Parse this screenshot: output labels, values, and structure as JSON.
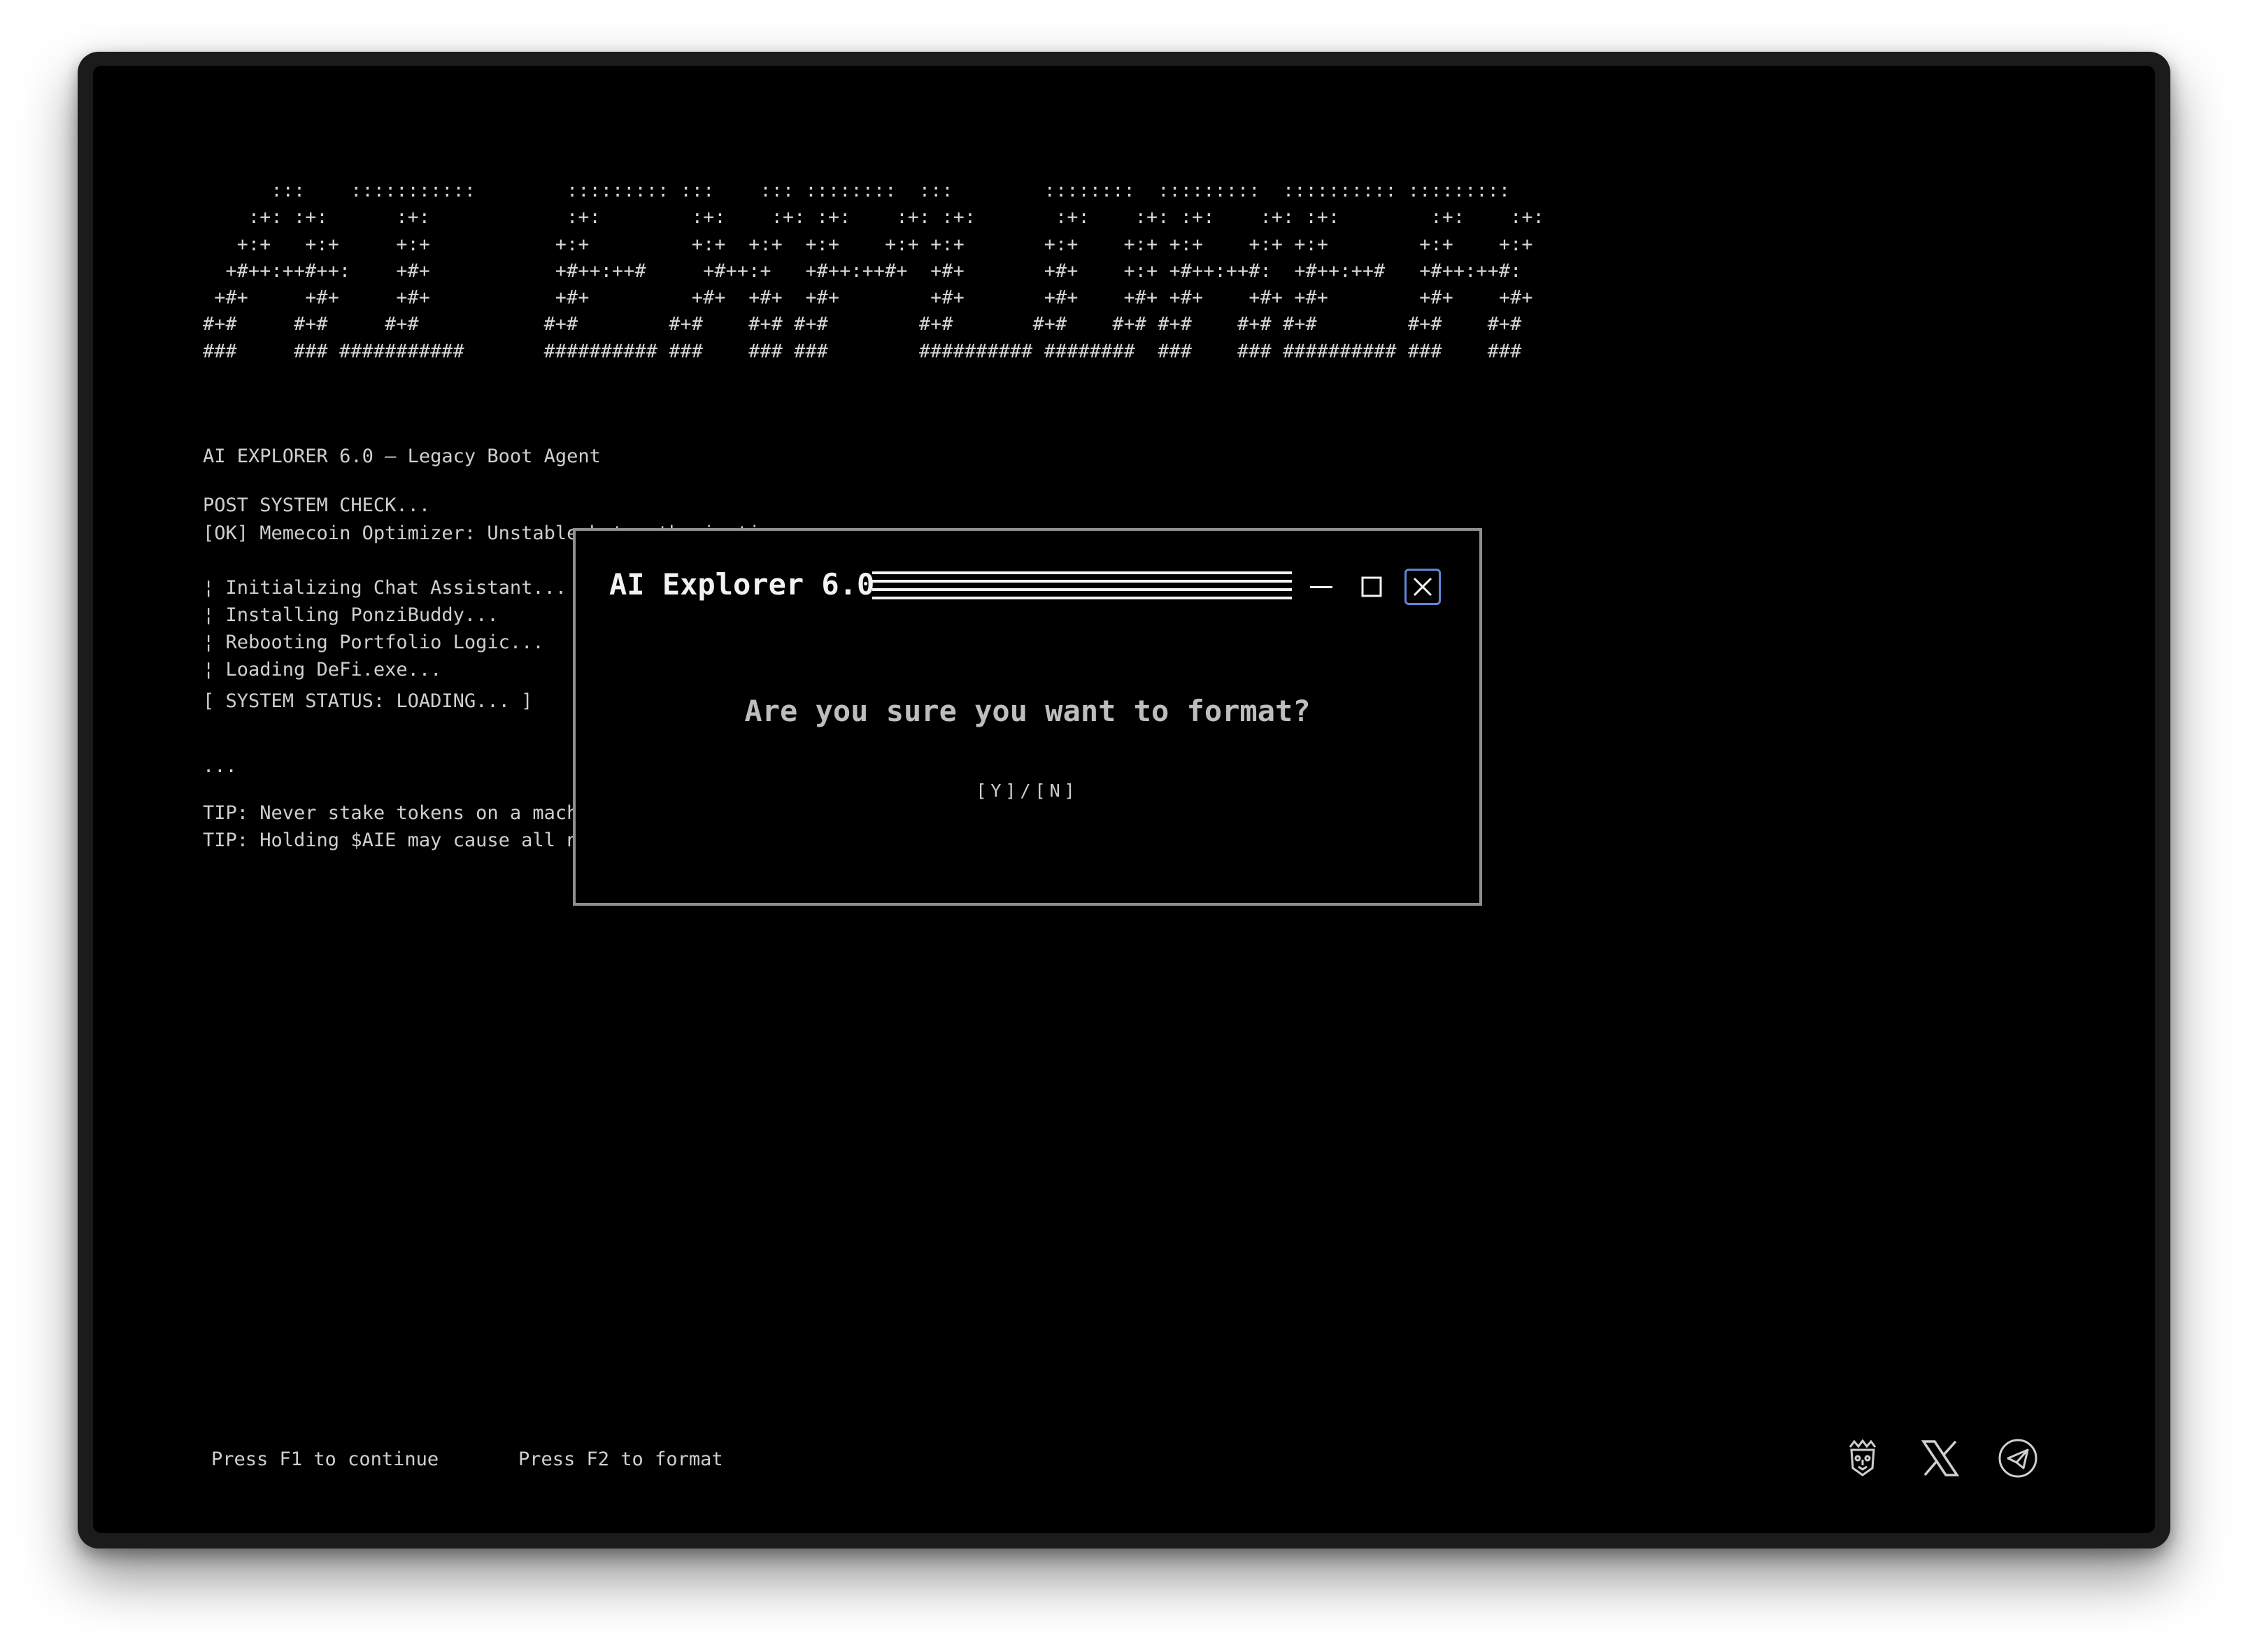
{
  "ascii_logo": "      :::    :::::::::::        ::::::::: :::    ::: ::::::::  :::        ::::::::  :::::::::  :::::::::: ::::::::: \n    :+: :+:      :+:            :+:        :+:    :+: :+:    :+: :+:       :+:    :+: :+:    :+: :+:        :+:    :+: \n   +:+   +:+     +:+           +:+         +:+  +:+  +:+    +:+ +:+       +:+    +:+ +:+    +:+ +:+        +:+    +:+  \n  +#++:++#++:    +#+           +#++:++#     +#++:+   +#++:++#+  +#+       +#+    +:+ +#++:++#:  +#++:++#   +#++:++#:    \n +#+     +#+     +#+           +#+         +#+  +#+  +#+        +#+       +#+    +#+ +#+    +#+ +#+        +#+    +#+    \n#+#     #+#     #+#           #+#        #+#    #+# #+#        #+#       #+#    #+# #+#    #+# #+#        #+#    #+#     \n###     ### ###########       ########## ###    ### ###        ########## ########  ###    ### ########## ###    ###      ",
  "terminal": {
    "header": "AI EXPLORER 6.0 — Legacy Boot Agent",
    "post_check": "POST SYSTEM CHECK...",
    "ok_line": "[OK] Memecoin Optimizer: Unstable but enthusiastic",
    "steps": [
      "¦ Initializing Chat Assistant...",
      "¦ Installing PonziBuddy...",
      "¦ Rebooting Portfolio Logic...",
      "¦ Loading DeFi.exe..."
    ],
    "status": "[ SYSTEM STATUS: LOADING... ]",
    "ellipsis": "...",
    "tip1": "TIP: Never stake tokens on a machine that",
    "tip2": "TIP: Holding $AIE may cause all nearby ass"
  },
  "dialog": {
    "title": "AI Explorer 6.0",
    "message": "Are you sure you want to format?",
    "choice": "[Y]/[N]"
  },
  "footer": {
    "continue_hint": "Press F1 to continue",
    "format_hint": "Press F2 to format"
  },
  "icons": {
    "minimize": "minimize-icon",
    "maximize": "maximize-icon",
    "close": "close-icon",
    "social": [
      "lion-crest-icon",
      "x-logo-icon",
      "telegram-icon"
    ]
  },
  "colors": {
    "background": "#000000",
    "text": "#cfcfcf",
    "dialog_border": "#8f8f8f",
    "close_accent": "#5f86d6",
    "progress": "#8a8a8a"
  }
}
